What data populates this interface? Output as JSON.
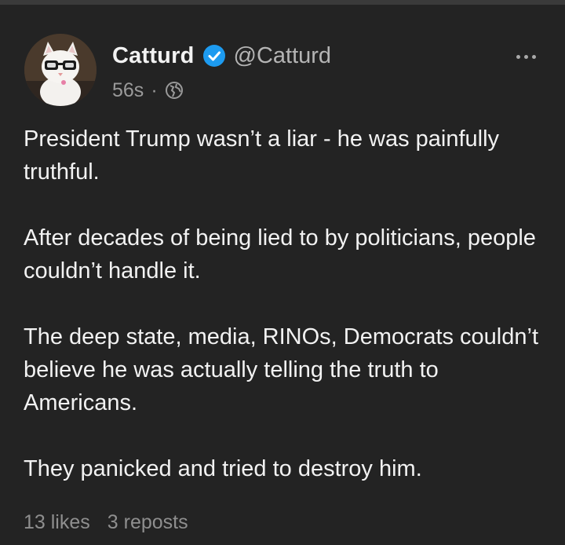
{
  "post": {
    "author_name": "Catturd",
    "author_handle": "@Catturd",
    "timestamp": "56s",
    "separator": "·",
    "paragraphs": [
      "President Trump wasn’t a liar - he was painfully truthful.",
      "After decades of being lied to by politicians, people couldn’t handle it.",
      "The deep state, media, RINOs, Democrats couldn’t believe he was actually telling the truth to Americans.",
      "They panicked and tried to destroy him."
    ],
    "likes": "13 likes",
    "reposts": "3 reposts"
  },
  "icons": {
    "verified": "verified-badge-icon",
    "visibility": "globe-icon",
    "more": "more-options-icon"
  },
  "colors": {
    "background": "#232323",
    "text": "#f2f2f2",
    "muted": "#9a9a9a",
    "verified_blue": "#1d9bf0"
  }
}
